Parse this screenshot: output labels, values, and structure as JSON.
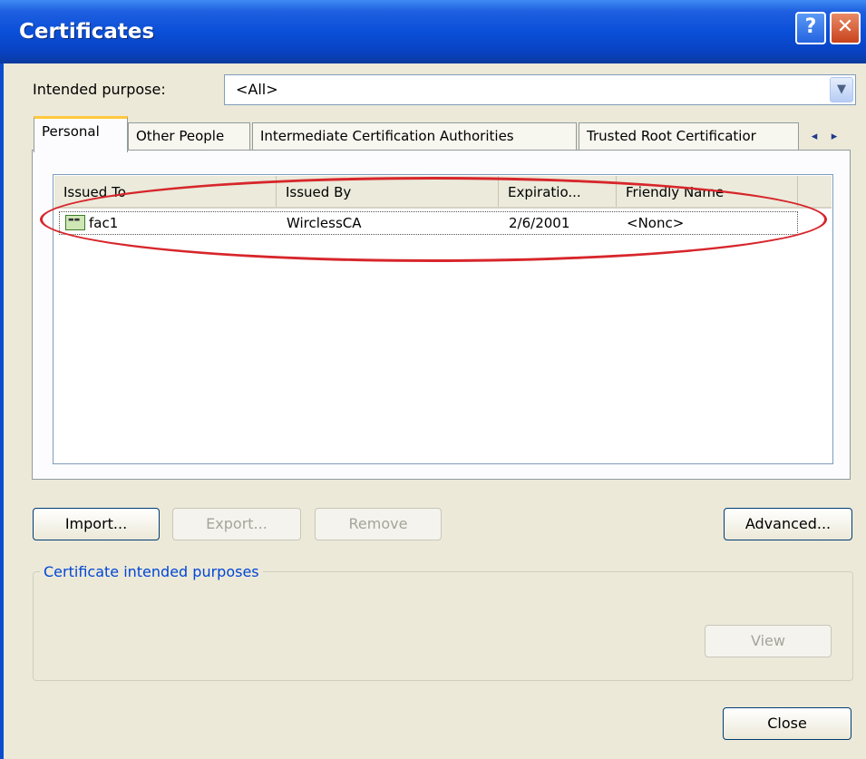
{
  "window": {
    "title": "Certificates",
    "help_glyph": "?",
    "close_glyph": "✕"
  },
  "purpose": {
    "label": "Intended purpose:",
    "value": "<All>"
  },
  "tabs": [
    {
      "label": "Personal",
      "active": true
    },
    {
      "label": "Other People",
      "active": false
    },
    {
      "label": "Intermediate Certification Authorities",
      "active": false
    },
    {
      "label": "Trusted Root Certificatior",
      "active": false
    }
  ],
  "tab_scroll": {
    "left": "◂",
    "right": "▸"
  },
  "list": {
    "columns": [
      "Issued To",
      "Issued By",
      "Expiratio...",
      "Friendly Name"
    ],
    "rows": [
      {
        "issued_to": "fac1",
        "issued_by": "WirclessCA",
        "expiration": "2/6/2001",
        "friendly_name": "<Nonc>"
      }
    ]
  },
  "buttons": {
    "import": "Import...",
    "export": "Export...",
    "remove": "Remove",
    "advanced": "Advanced...",
    "view": "View",
    "close": "Close"
  },
  "purposes_group": {
    "caption": "Certificate intended purposes"
  },
  "colors": {
    "titlebar": "#0a4fd8",
    "highlight": "#d7262b",
    "dialog_bg": "#ece9d8"
  }
}
